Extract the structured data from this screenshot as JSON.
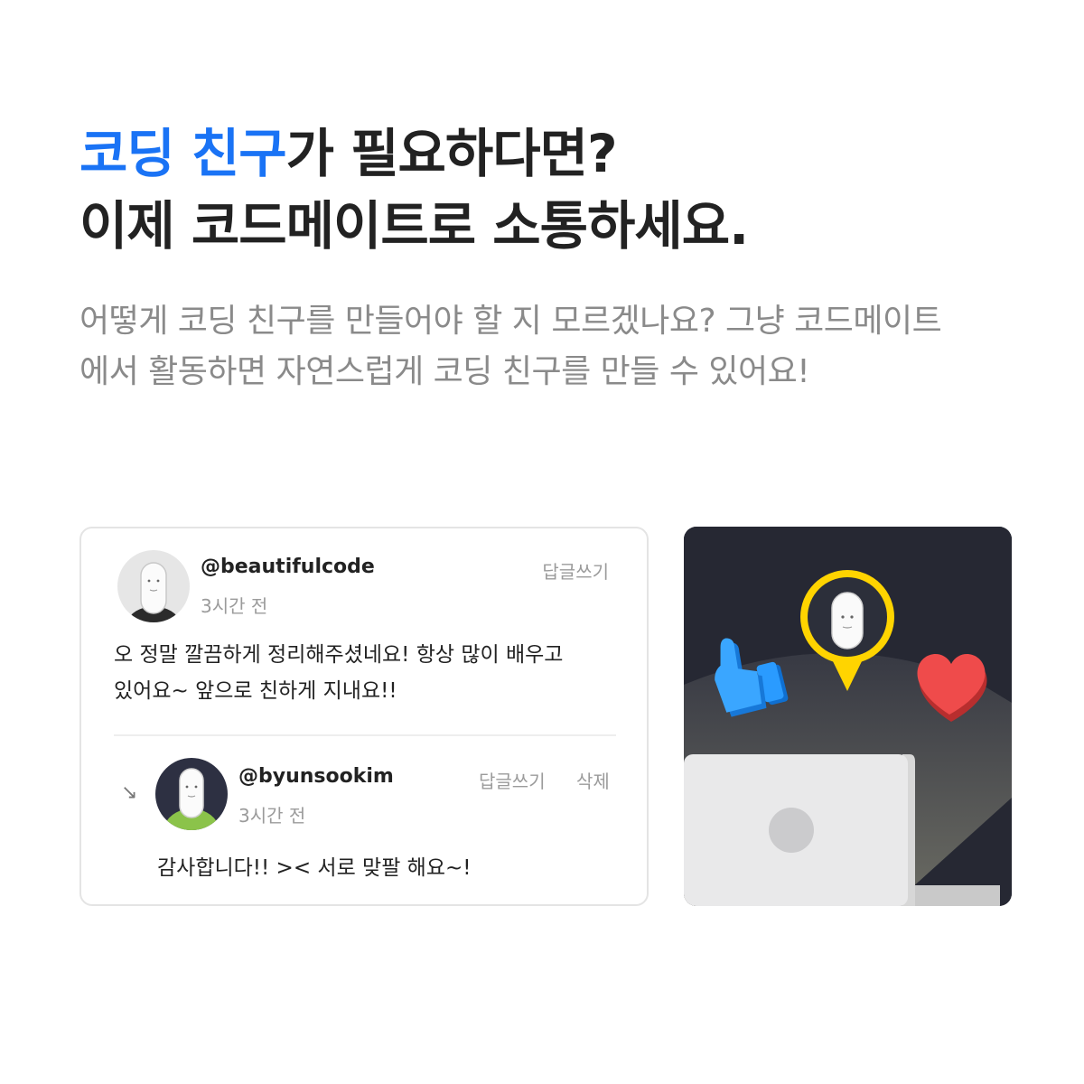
{
  "headline": {
    "accent": "코딩 친구",
    "line1_rest": "가 필요하다면?",
    "line2": "이제 코드메이트로 소통하세요."
  },
  "description": {
    "line1": "어떻게 코딩 친구를 만들어야 할 지 모르겠나요? 그냥 코드메이트",
    "line2": "에서 활동하면 자연스럽게 코딩 친구를 만들 수 있어요!"
  },
  "comment": {
    "username": "@beautifulcode",
    "time": "3시간 전",
    "reply_label": "답글쓰기",
    "body_line1": "오 정말 깔끔하게 정리해주셨네요! 항상 많이 배우고",
    "body_line2": "있어요~ 앞으로 친하게 지내요!!"
  },
  "reply": {
    "username": "@byunsookim",
    "time": "3시간 전",
    "reply_label": "답글쓰기",
    "delete_label": "삭제",
    "body": "감사합니다!! >< 서로 맞팔 해요~!"
  },
  "icons": {
    "reply_arrow": "↘",
    "illustration": [
      "location-pin-icon",
      "thumbs-up-icon",
      "heart-icon",
      "laptop-icon"
    ]
  },
  "colors": {
    "accent": "#1a73f5",
    "heading": "#222222",
    "muted": "#8a8a8a",
    "illustration_bg": "#262833",
    "pin": "#ffd400",
    "like": "#1e90ff",
    "heart": "#e84545",
    "hoodie_green": "#8bc34a"
  }
}
